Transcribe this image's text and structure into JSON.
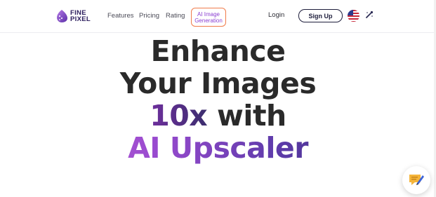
{
  "logo": {
    "line1": "FINE",
    "line2": "PIXEL"
  },
  "nav": {
    "features": "Features",
    "pricing": "Pricing",
    "rating": "Rating",
    "ai_line1": "AI Image",
    "ai_line2": "Generation"
  },
  "header": {
    "login": "Login",
    "signup": "Sign Up",
    "language_flag": "us-flag-icon",
    "tool_icon": "magic-wand-icon"
  },
  "hero": {
    "line1": "Enhance",
    "line2": "Your Images",
    "line3_highlight": "10x",
    "line3_rest": " with",
    "line4": "AI Upscaler"
  },
  "colors": {
    "accent_orange": "#f07b4a",
    "accent_purple": "#8a3fd1",
    "brand_navy": "#1e1e3c"
  },
  "chat": {
    "icon": "chat-note-icon"
  }
}
